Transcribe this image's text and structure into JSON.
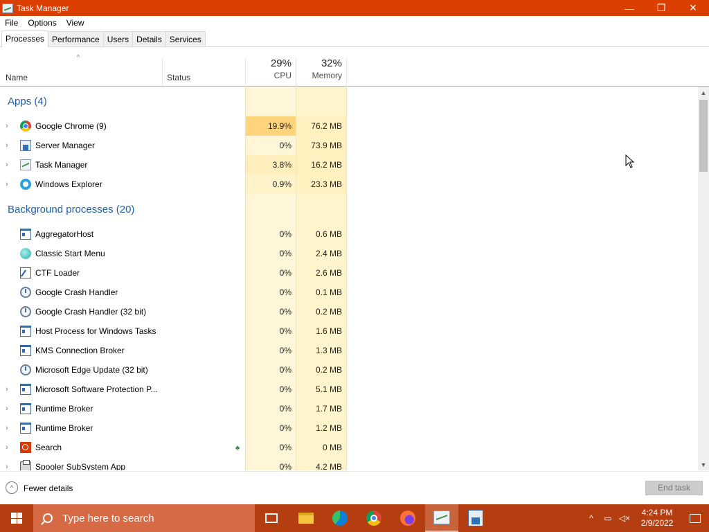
{
  "window": {
    "title": "Task Manager",
    "minimize_glyph": "—",
    "restore_glyph": "❐",
    "close_glyph": "✕"
  },
  "menu": [
    "File",
    "Options",
    "View"
  ],
  "tabs": [
    "Processes",
    "Performance",
    "Users",
    "Details",
    "Services"
  ],
  "active_tab": "Processes",
  "columns": {
    "name": "Name",
    "status": "Status",
    "cpu": {
      "percent": "29%",
      "label": "CPU"
    },
    "memory": {
      "percent": "32%",
      "label": "Memory"
    }
  },
  "groups": [
    {
      "title": "Apps (4)",
      "processes": [
        {
          "name": "Google Chrome (9)",
          "icon": "chrome-icon",
          "expandable": true,
          "cpu": "19.9%",
          "memory": "76.2 MB",
          "cpu_highlight": "#ffd47a",
          "mem_highlight": "#fff0c0"
        },
        {
          "name": "Server Manager",
          "icon": "server-manager-icon",
          "expandable": true,
          "cpu": "0%",
          "memory": "73.9 MB",
          "cpu_highlight": "",
          "mem_highlight": "#fff0c0"
        },
        {
          "name": "Task Manager",
          "icon": "task-manager-icon",
          "expandable": true,
          "cpu": "3.8%",
          "memory": "16.2 MB",
          "cpu_highlight": "#ffefbe",
          "mem_highlight": "#fff0c0"
        },
        {
          "name": "Windows Explorer",
          "icon": "windows-explorer-icon",
          "expandable": true,
          "cpu": "0.9%",
          "memory": "23.3 MB",
          "cpu_highlight": "#fff3c9",
          "mem_highlight": "#fff0c0"
        }
      ]
    },
    {
      "title": "Background processes (20)",
      "processes": [
        {
          "name": "AggregatorHost",
          "icon": "window-icon",
          "expandable": false,
          "cpu": "0%",
          "memory": "0.6 MB"
        },
        {
          "name": "Classic Start Menu",
          "icon": "classic-start-menu-icon",
          "expandable": false,
          "cpu": "0%",
          "memory": "2.4 MB"
        },
        {
          "name": "CTF Loader",
          "icon": "ctf-loader-icon",
          "expandable": false,
          "cpu": "0%",
          "memory": "2.6 MB"
        },
        {
          "name": "Google Crash Handler",
          "icon": "crash-handler-icon",
          "expandable": false,
          "cpu": "0%",
          "memory": "0.1 MB"
        },
        {
          "name": "Google Crash Handler (32 bit)",
          "icon": "crash-handler-icon",
          "expandable": false,
          "cpu": "0%",
          "memory": "0.2 MB"
        },
        {
          "name": "Host Process for Windows Tasks",
          "icon": "window-icon",
          "expandable": false,
          "cpu": "0%",
          "memory": "1.6 MB"
        },
        {
          "name": "KMS Connection Broker",
          "icon": "window-icon",
          "expandable": false,
          "cpu": "0%",
          "memory": "1.3 MB"
        },
        {
          "name": "Microsoft Edge Update (32 bit)",
          "icon": "crash-handler-icon",
          "expandable": false,
          "cpu": "0%",
          "memory": "0.2 MB"
        },
        {
          "name": "Microsoft Software Protection P...",
          "icon": "window-icon",
          "expandable": true,
          "cpu": "0%",
          "memory": "5.1 MB"
        },
        {
          "name": "Runtime Broker",
          "icon": "window-icon",
          "expandable": true,
          "cpu": "0%",
          "memory": "1.7 MB"
        },
        {
          "name": "Runtime Broker",
          "icon": "window-icon",
          "expandable": true,
          "cpu": "0%",
          "memory": "1.2 MB"
        },
        {
          "name": "Search",
          "icon": "search-app-icon",
          "expandable": true,
          "cpu": "0%",
          "memory": "0 MB",
          "status_icon": "leaf-icon"
        },
        {
          "name": "Spooler SubSystem App",
          "icon": "spooler-icon",
          "expandable": true,
          "cpu": "0%",
          "memory": "4.2 MB"
        }
      ]
    }
  ],
  "footer": {
    "fewer_details": "Fewer details",
    "end_task": "End task"
  },
  "taskbar": {
    "search_placeholder": "Type here to search",
    "apps": [
      "task-view-icon",
      "file-explorer-icon",
      "edge-icon",
      "chrome-icon",
      "firefox-icon",
      "task-manager-icon",
      "server-manager-icon"
    ],
    "active_app": "task-manager-icon",
    "time": "4:24 PM",
    "date": "2/9/2022"
  },
  "colors": {
    "titlebar": "#db3f00",
    "taskbar": "#b53e10",
    "group_title": "#1e5fa8",
    "cpu_column": "#fff6d7",
    "memory_column": "#fff4cc"
  }
}
